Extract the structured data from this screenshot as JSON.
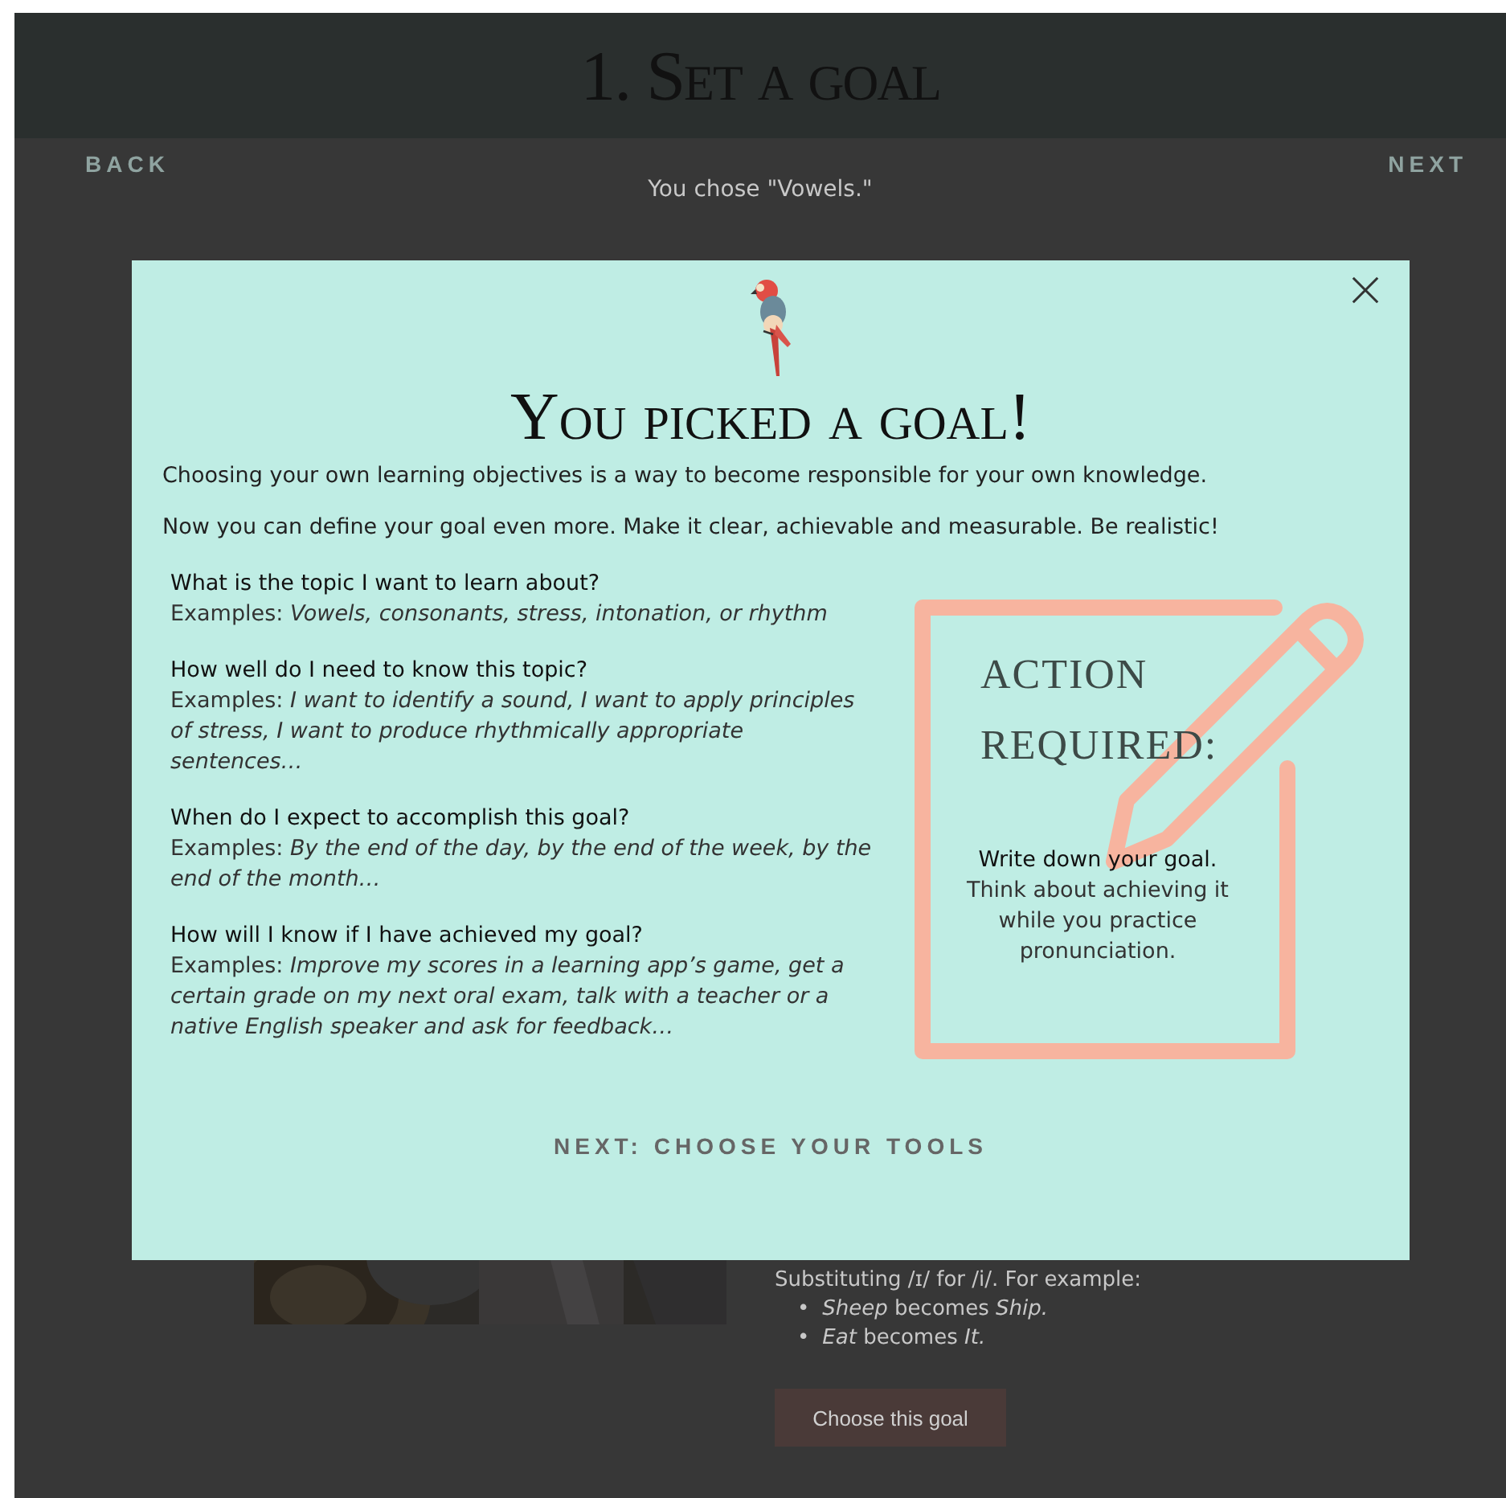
{
  "header": {
    "title": "1. Set a goal"
  },
  "nav": {
    "back": "BACK",
    "next": "NEXT"
  },
  "chosen": "You chose \"Vowels.\"",
  "background_section": {
    "text": "Substituting /ɪ/ for /i/. For example:",
    "bullets": [
      {
        "marker": "•",
        "text": "*Sheep* becomes *Ship.*"
      },
      {
        "marker": "•",
        "text": "*Eat* becomes *It.*"
      }
    ],
    "button": "Choose this goal"
  },
  "modal": {
    "title": "You picked a goal!",
    "intro": [
      "Choosing your own learning objectives is a way to become responsible for your own knowledge.",
      "Now you can define your goal even more. Make it clear, achievable and measurable. Be realistic!"
    ],
    "questions": [
      {
        "question": "What is the topic I want to learn about?",
        "examples": "Examples: *Vowels, consonants, stress, intonation, or rhythm*"
      },
      {
        "question": "How well do I need to know this topic?",
        "examples": "Examples: *I want to identify a sound, I want to apply principles of stress, I want to produce rhythmically appropriate sentences…*"
      },
      {
        "question": "When do I expect to accomplish this goal?",
        "examples": "Examples: *By the end of the day, by the end of the week, by the end of the month…*"
      },
      {
        "question": "How will I know if I have achieved my goal?",
        "examples": "Examples: *Improve my scores in a learning app’s game, get a certain grade on my next oral exam, talk with a teacher or a native English speaker and ask for feedback…*"
      }
    ],
    "action": {
      "heading": "ACTION REQUIRED:",
      "instruction": "Write down your goal.",
      "note": "Think about achieving it while you practice pronunciation."
    },
    "next_button": "NEXT: CHOOSE YOUR TOOLS"
  }
}
